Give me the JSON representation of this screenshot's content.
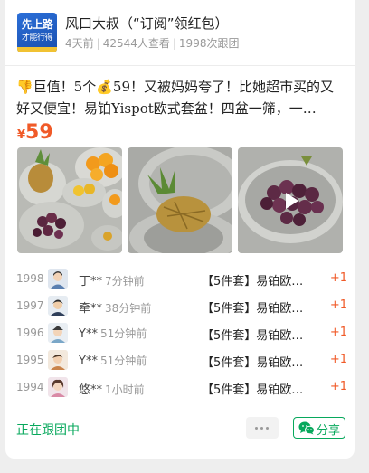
{
  "group": {
    "logo_text_main": "先上路",
    "logo_text_sub": "才能行得",
    "title": "风口大叔（“订阅”领红包）",
    "posted": "4天前",
    "views": "42544人查看",
    "joined": "1998次跟团"
  },
  "post": {
    "description_line1": "👎巨值！5个💰59！又被妈妈夸了！比她超市买的又",
    "description_line2": "好又便宜！易铂Yispot欧式套盆！四盆一筛，一…",
    "price_symbol": "¥",
    "price_value": "59"
  },
  "records": [
    {
      "num": "1998",
      "name": "丁**",
      "time": "7分钟前",
      "product": "【5件套】易铂欧…",
      "qty": "+1"
    },
    {
      "num": "1997",
      "name": "牵**",
      "time": "38分钟前",
      "product": "【5件套】易铂欧…",
      "qty": "+1"
    },
    {
      "num": "1996",
      "name": "Y**",
      "time": "51分钟前",
      "product": "【5件套】易铂欧…",
      "qty": "+1"
    },
    {
      "num": "1995",
      "name": "Y**",
      "time": "51分钟前",
      "product": "【5件套】易铂欧…",
      "qty": "+1"
    },
    {
      "num": "1994",
      "name": "悠**",
      "time": "1小时前",
      "product": "【5件套】易铂欧…",
      "qty": "+1"
    }
  ],
  "footer": {
    "status": "正在跟团中",
    "share_label": "分享"
  },
  "colors": {
    "accent_orange": "#f05a28",
    "accent_green": "#07a85c"
  },
  "icons": [
    "more-dots-icon",
    "wechat-icon",
    "play-icon"
  ]
}
